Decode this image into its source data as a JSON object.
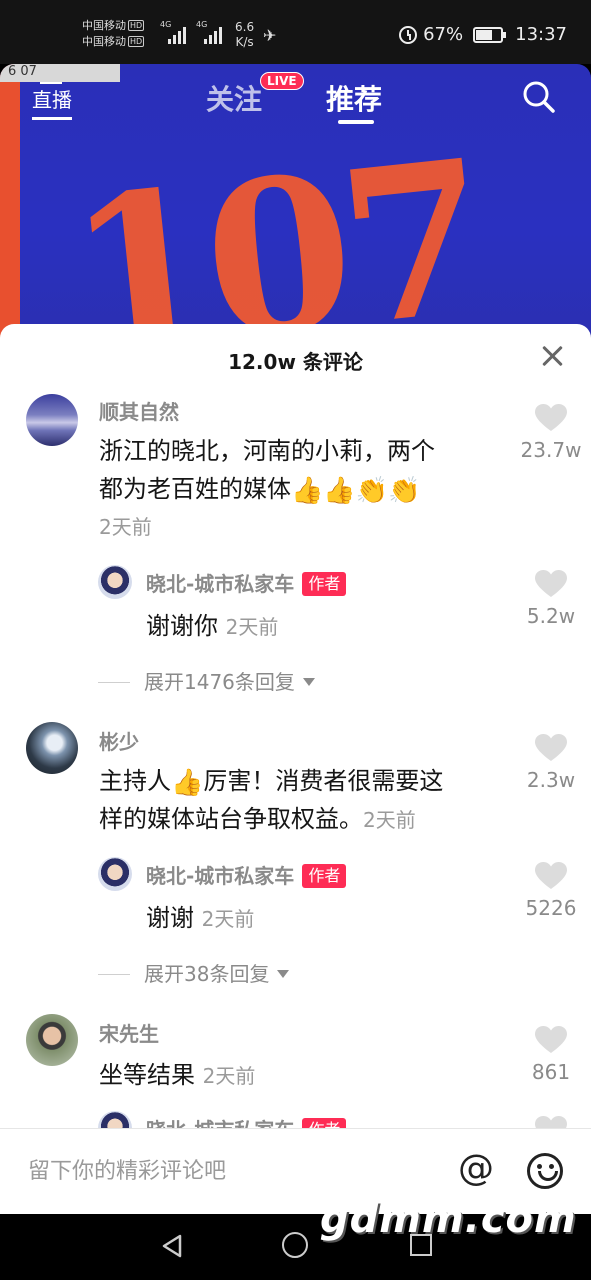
{
  "status_bar": {
    "carrier1": "中国移动",
    "carrier2": "中国移动",
    "hd": "HD",
    "net1": "4G",
    "net2": "4G",
    "speed_value": "6.6",
    "speed_unit": "K/s",
    "battery_percent": "67%",
    "battery_level": 0.67,
    "time": "13:37"
  },
  "top_nav": {
    "live_label": "直播",
    "follow_tab": "关注",
    "live_badge": "LIVE",
    "recommend_tab": "推荐"
  },
  "video": {
    "plate_text": "6 07",
    "big_text": "107"
  },
  "comments_panel": {
    "title": "12.0w 条评论"
  },
  "comments": [
    {
      "user": "顺其自然",
      "line1": "浙江的晓北，河南的小莉，两个",
      "line2": "都为老百姓的媒体",
      "emojis": "👍👍👏👏",
      "time": "2天前",
      "likes": "23.7w",
      "reply": {
        "user": "晓北-城市私家车",
        "badge": "作者",
        "text": "谢谢你",
        "time": "2天前",
        "likes": "5.2w"
      },
      "expand": "展开1476条回复"
    },
    {
      "user": "彬少",
      "line1_pre": "主持人",
      "line1_emoji": "👍",
      "line1_post": "厉害！消费者很需要这",
      "line2": "样的媒体站台争取权益。",
      "time": "2天前",
      "likes": "2.3w",
      "reply": {
        "user": "晓北-城市私家车",
        "badge": "作者",
        "text": "谢谢",
        "time": "2天前",
        "likes": "5226"
      },
      "expand": "展开38条回复"
    },
    {
      "user": "宋先生",
      "text": "坐等结果",
      "time": "2天前",
      "likes": "861",
      "reply": {
        "user": "晓北-城市私家车",
        "badge": "作者"
      }
    }
  ],
  "input_bar": {
    "placeholder": "留下你的精彩评论吧",
    "at_symbol": "@"
  },
  "watermark": "gdmm.com"
}
